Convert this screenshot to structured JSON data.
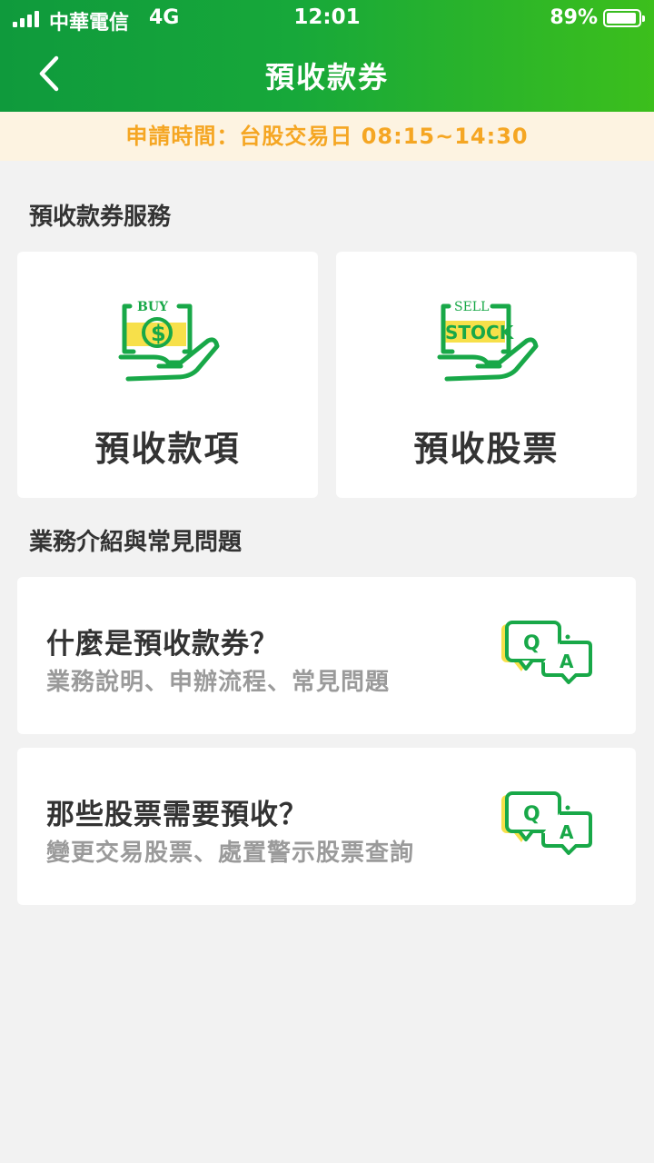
{
  "status_bar": {
    "carrier": "中華電信",
    "network": "4G",
    "time": "12:01",
    "battery": "89%"
  },
  "header": {
    "title": "預收款券",
    "back_icon": "chevron-left-icon"
  },
  "notice": {
    "text": "申請時間：台股交易日 08:15~14:30"
  },
  "services": {
    "title": "預收款券服務",
    "items": [
      {
        "label": "預收款項",
        "icon": "buy-money-hand-icon",
        "icon_text": [
          "BUY",
          "$"
        ]
      },
      {
        "label": "預收股票",
        "icon": "sell-stock-hand-icon",
        "icon_text": [
          "SELL",
          "STOCK"
        ]
      }
    ]
  },
  "faq": {
    "title": "業務介紹與常見問題",
    "items": [
      {
        "title": "什麼是預收款券？",
        "subtitle": "業務說明、申辦流程、常見問題",
        "icon": "qa-chat-icon"
      },
      {
        "title": "那些股票需要預收？",
        "subtitle": "變更交易股票、處置警示股票查詢",
        "icon": "qa-chat-icon"
      }
    ]
  },
  "colors": {
    "header_start": "#0f9a3c",
    "header_end": "#3cbf1c",
    "notice_bg": "#fdf3e1",
    "notice_text": "#f5a623",
    "icon_green": "#18a848",
    "icon_yellow": "#f7e04a",
    "background": "#f2f2f2"
  }
}
